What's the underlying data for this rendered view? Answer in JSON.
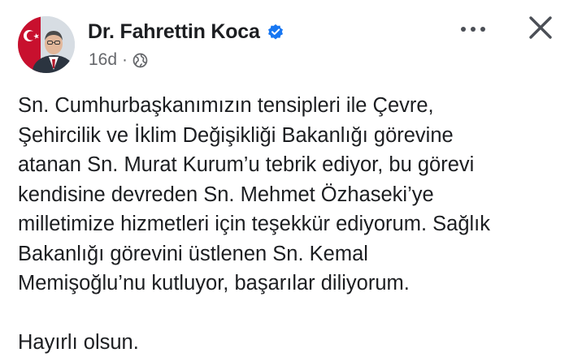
{
  "post": {
    "author": "Dr. Fahrettin Koca",
    "timestamp": "16d",
    "separator": "·",
    "audience_icon": "globe-icon",
    "verified_icon": "verified-badge-icon",
    "more_icon": "more-options-icon",
    "close_icon": "close-icon",
    "lines": [
      "Sn. Cumhurbaşkanımızın tensipleri ile Çevre,",
      "Şehircilik ve İklim Değişikliği Bakanlığı görevine",
      "atanan Sn. Murat Kurum’u tebrik ediyor, bu görevi",
      "kendisine devreden Sn. Mehmet Özhaseki’ye",
      "milletimize hizmetleri için teşekkür ediyorum. Sağlık",
      "Bakanlığı görevini üstlenen Sn. Kemal",
      "Memişoğlu’nu kutluyor, başarılar diliyorum."
    ],
    "closing": "Hayırlı olsun."
  },
  "colors": {
    "text": "#1c1e21",
    "secondary": "#65676b",
    "verified": "#1877f2"
  }
}
